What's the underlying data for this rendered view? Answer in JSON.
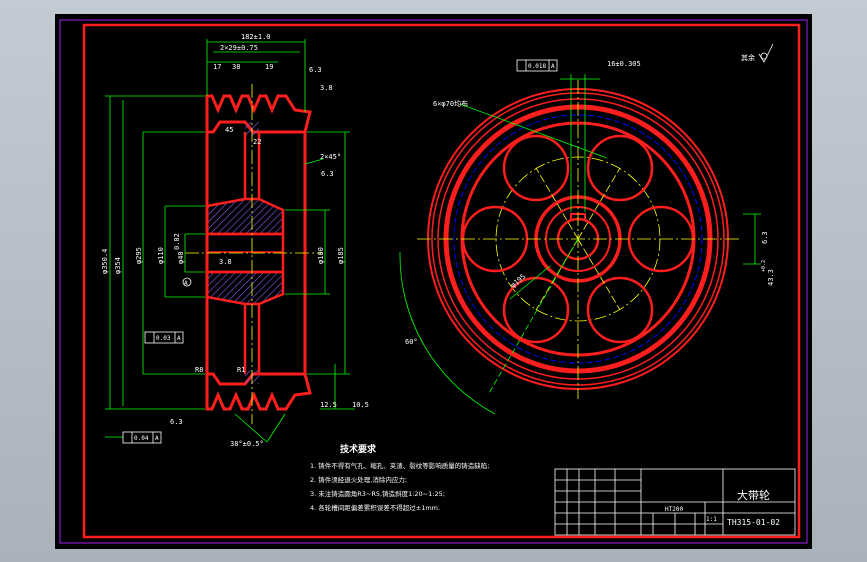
{
  "colors": {
    "outline": "#ff1e1e",
    "dimension": "#00ff00",
    "text": "#ffffff",
    "center": "#ffff00",
    "hidden": "#0000ff",
    "hatch": "#8a5cff",
    "sheet_border": "#a020f0",
    "title_block": "#ffffff"
  },
  "side_view": {
    "dims": {
      "top_overall": "182±1.0",
      "top_groove_span": "2×29±0.75",
      "top_17": "17",
      "top_38": "38",
      "top_19": "19",
      "rim_3_8": "3.8",
      "ra_top": "6.3",
      "d_45": "45",
      "d_22": "22",
      "chamfer": "2×45°",
      "ra_chamfer": "6.3",
      "od_1": "φ350.4",
      "od_2": "φ354",
      "d_295": "φ295",
      "d_110": "φ110",
      "d_180": "φ180",
      "d_100": "φ100",
      "d_185": "φ185",
      "hub_38": "3.8",
      "bore": "φ40",
      "geom_a": "0.02",
      "tol_perp": "0.03",
      "tol_runout": "0.04",
      "r_r8": "R8",
      "r_r1": "R1",
      "ra_bottom": "6.3",
      "ra_10": "10.5",
      "ra_right": "12.5",
      "angle": "38°±0.5°",
      "datum_a": "A"
    }
  },
  "front_view": {
    "dims": {
      "key_width": "16±0.305",
      "sym_tol": "0.018",
      "sym_datum": "A",
      "holes": "6×φ70均布",
      "pcd": "φ195",
      "keyway_depth": "43.3",
      "keyway_tol": "+0.2",
      "ra_key": "6.3",
      "angle_60": "60°",
      "ra_remaining_label": "其余",
      "ra_remaining_value": "12.5"
    }
  },
  "tech_req": {
    "title": "技术要求",
    "items": [
      "1. 铸件不得有气孔、缩孔、夹渣、裂纹等影响质量的铸造缺陷;",
      "2. 铸件须经退火处理,消除内应力;",
      "3. 未注铸造圆角R3~R5,铸造斜度1:20~1:25;",
      "4. 各轮槽间距偏差累积误差不得超过±1mm."
    ]
  },
  "title_block": {
    "part_name": "大带轮",
    "drawing_no": "TH315-01-02",
    "material": "HT200",
    "scale": "1:1"
  }
}
